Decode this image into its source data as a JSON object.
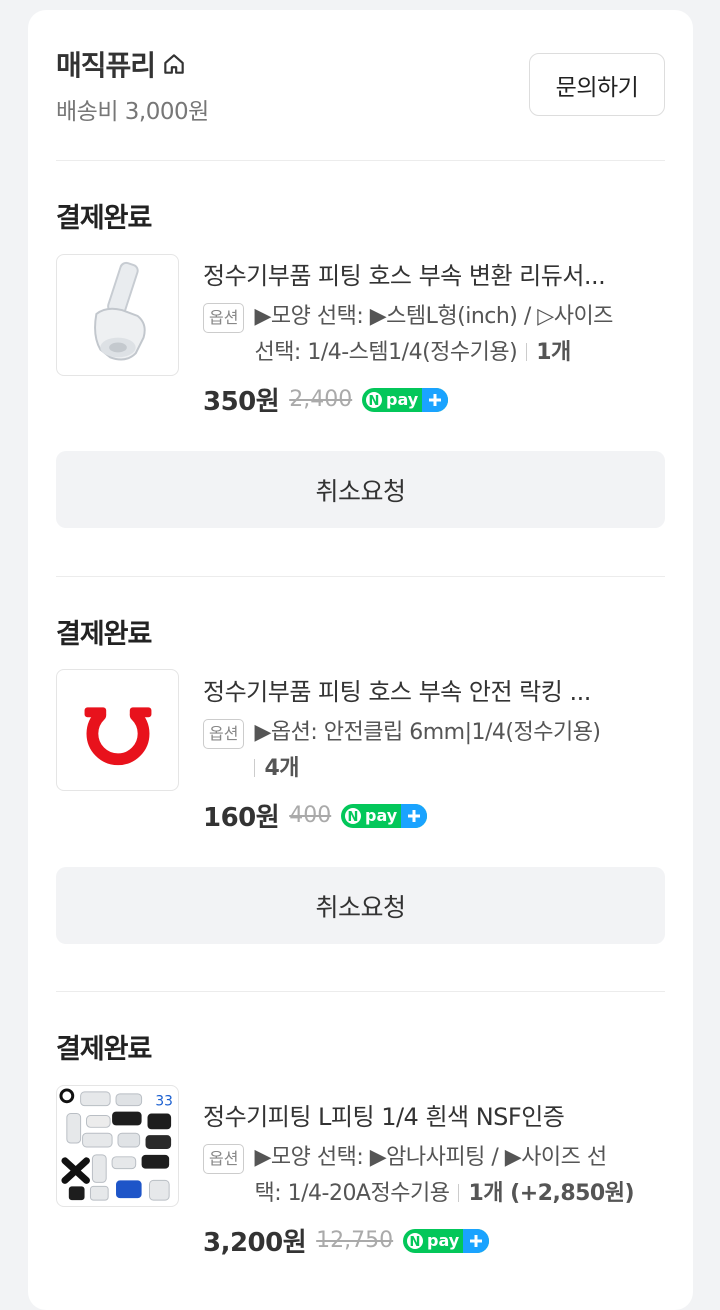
{
  "store": {
    "name": "매직퓨리",
    "shipping": "배송비 3,000원",
    "inquiry_label": "문의하기"
  },
  "orders": [
    {
      "status": "결제완료",
      "product_name": "정수기부품 피팅 호스 부속 변환 리듀서...",
      "option_badge": "옵션",
      "option_line1": "▶모양 선택: ▶스템L형(inch) / ▷사이즈",
      "option_line2": "선택: 1/4-스템1/4(정수기용)",
      "quantity": "1개",
      "price": "350원",
      "original_price": "2,400",
      "cancel_label": "취소요청",
      "thumb_icon": "white-elbow-fitting"
    },
    {
      "status": "결제완료",
      "product_name": "정수기부품 피팅 호스 부속 안전 락킹 ...",
      "option_badge": "옵션",
      "option_line1": "▶옵션: 안전클립 6mm|1/4(정수기용)",
      "option_line2": "",
      "quantity": "4개",
      "price": "160원",
      "original_price": "400",
      "cancel_label": "취소요청",
      "thumb_icon": "red-clip"
    },
    {
      "status": "결제완료",
      "product_name": "정수기피팅 L피팅 1/4 흰색 NSF인증",
      "option_badge": "옵션",
      "option_line1": "▶모양 선택: ▶암나사피팅 / ▶사이즈 선",
      "option_line2": "택: 1/4-20A정수기용",
      "quantity": "1개 (+2,850원)",
      "price": "3,200원",
      "original_price": "12,750",
      "thumb_icon": "fittings-collage"
    }
  ],
  "npay_label": "pay",
  "colors": {
    "npay_green": "#03c75a",
    "npay_blue": "#1aa3ff",
    "clip_red": "#e8121c"
  }
}
